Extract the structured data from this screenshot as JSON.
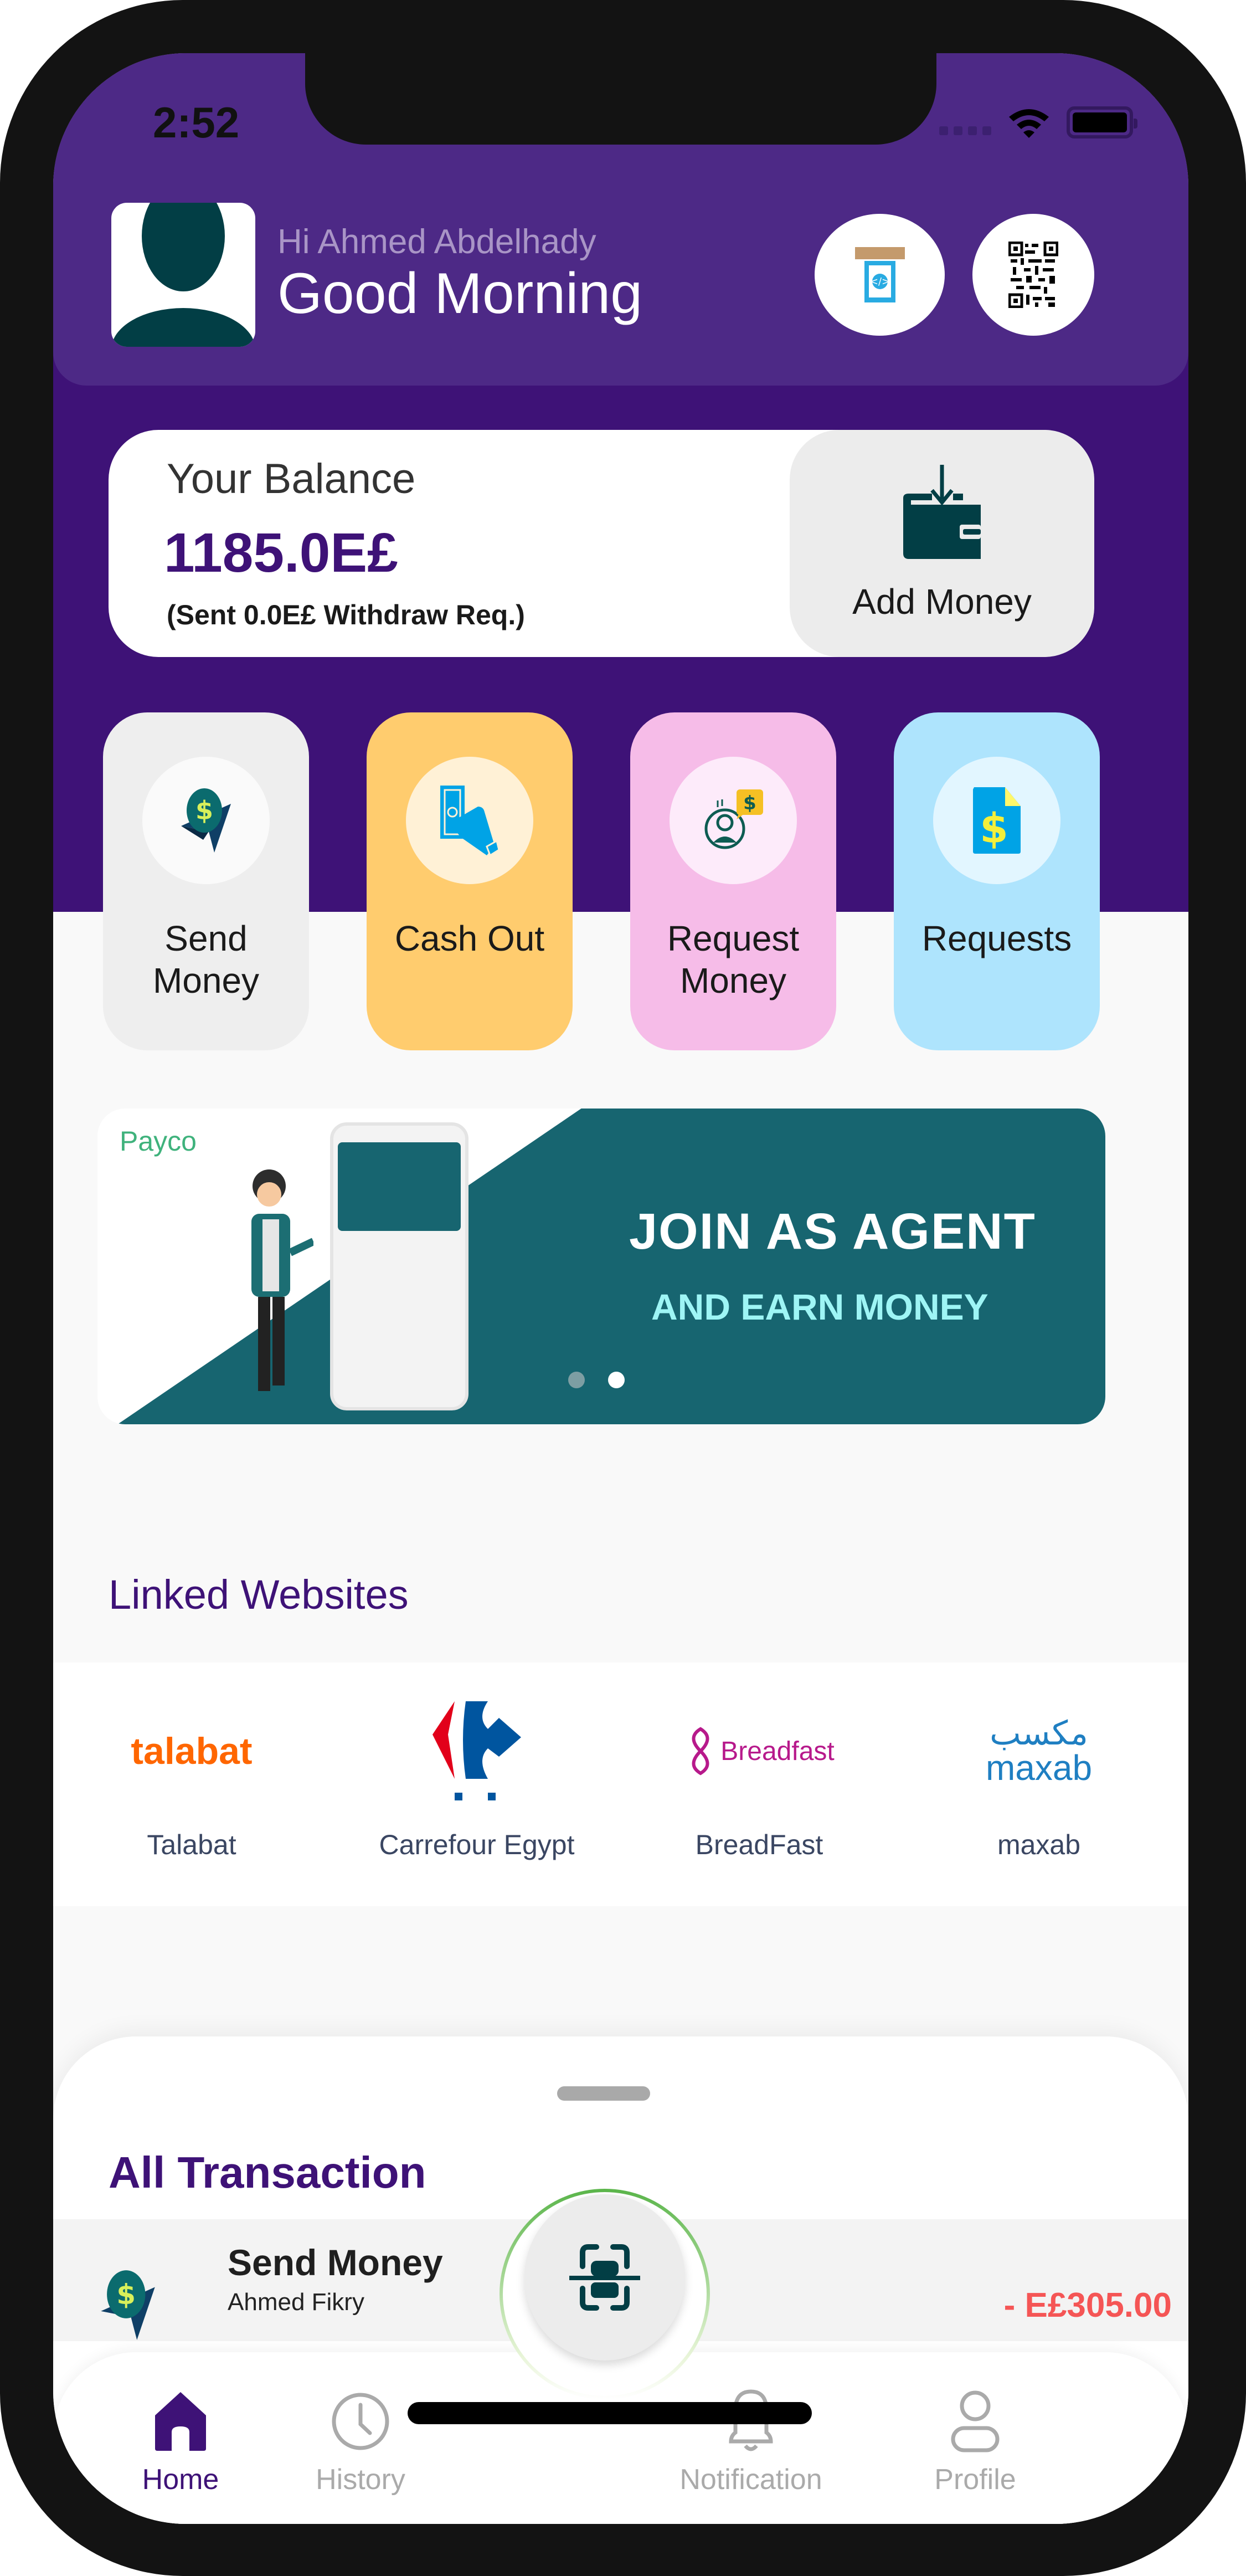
{
  "status_bar": {
    "time": "2:52"
  },
  "header": {
    "greeting_name": "Hi Ahmed Abdelhady",
    "greeting": "Good Morning",
    "atm_button_icon": "atm-cash-icon",
    "qr_button_icon": "qr-code-icon"
  },
  "balance": {
    "label": "Your Balance",
    "value": "1185.0E£",
    "sub": "(Sent 0.0E£ Withdraw Req.)",
    "add_money_label": "Add Money"
  },
  "actions": [
    {
      "label": "Send Money",
      "icon": "send-money-icon",
      "bg": "#eeeeee",
      "icon_bg": "#fafafa"
    },
    {
      "label": "Cash Out",
      "icon": "cash-out-icon",
      "bg": "#ffcc6e",
      "icon_bg": "#fff1d6"
    },
    {
      "label": "Request Money",
      "icon": "request-money-icon",
      "bg": "#f6bce8",
      "icon_bg": "#fdebfa"
    },
    {
      "label": "Requests",
      "icon": "requests-document-icon",
      "bg": "#aee4fd",
      "icon_bg": "#e2f6ff"
    }
  ],
  "banner": {
    "brand": "Payco",
    "headline": "JOIN AS AGENT",
    "subheadline": "AND EARN MONEY",
    "slides_total": 2,
    "active_slide": 2
  },
  "linked_websites": {
    "title": "Linked Websites",
    "items": [
      {
        "name": "Talabat",
        "logo_text": "talabat",
        "color": "#ff6600"
      },
      {
        "name": "Carrefour Egypt",
        "logo_text": "",
        "color": "#00559f"
      },
      {
        "name": "BreadFast",
        "logo_text": "Breadfast",
        "color": "#b7198b"
      },
      {
        "name": "maxab",
        "logo_text": "maxab",
        "color": "#1f7fc2"
      }
    ]
  },
  "transactions": {
    "title": "All Transaction",
    "items": [
      {
        "type": "Send Money",
        "counterparty": "Ahmed Fikry",
        "amount": "- E£305.00"
      }
    ]
  },
  "nav": {
    "items": [
      {
        "label": "Home",
        "active": true
      },
      {
        "label": "History",
        "active": false
      },
      {
        "label": "Notification",
        "active": false
      },
      {
        "label": "Profile",
        "active": false
      }
    ],
    "scan_icon": "scan-qr-icon"
  },
  "colors": {
    "primary": "#3e1277",
    "header": "#4d2986",
    "negative_amount": "#f55555",
    "nav_inactive": "#aaaaaa"
  }
}
